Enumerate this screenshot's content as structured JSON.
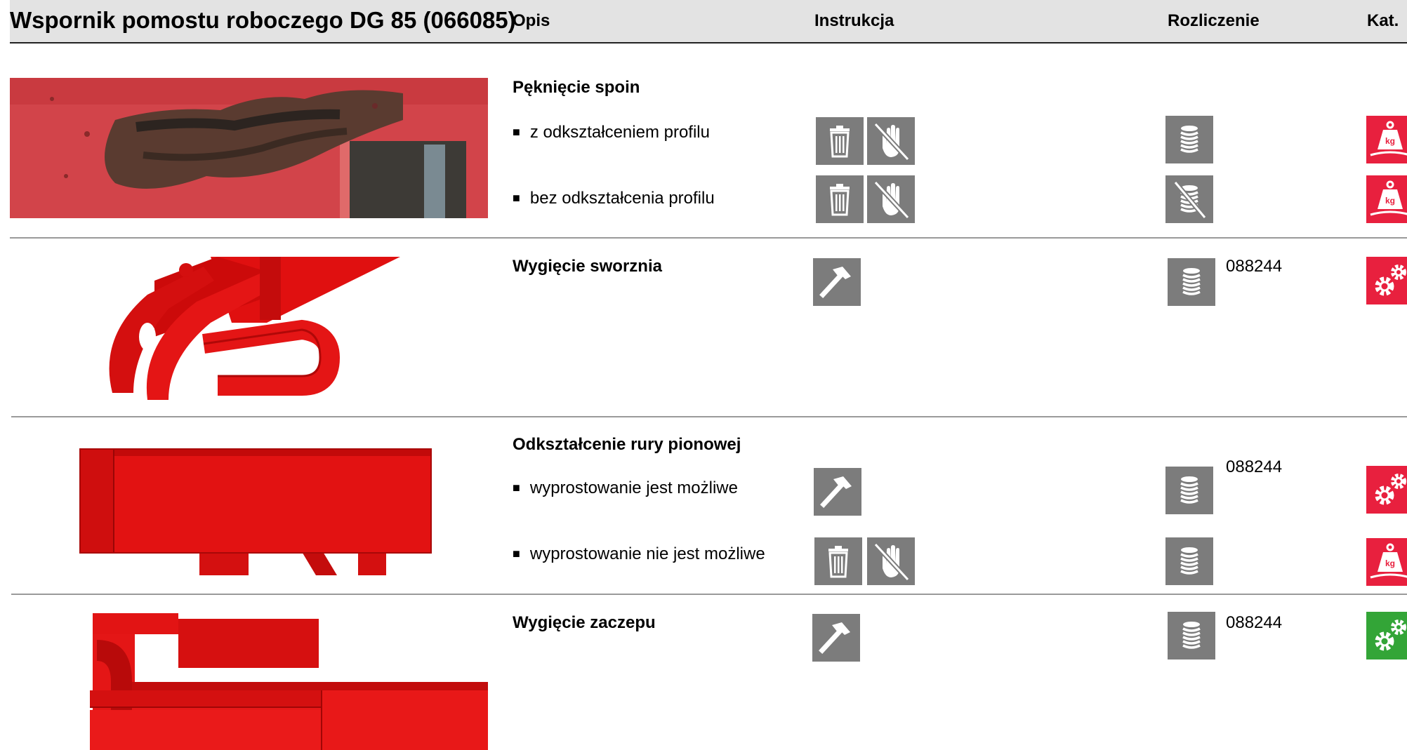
{
  "header": {
    "title": "Wspornik pomostu roboczego DG 85 (066085)",
    "columns": {
      "opis": "Opis",
      "instrukcja": "Instrukcja",
      "rozliczenie": "Rozliczenie",
      "kat": "Kat."
    }
  },
  "sections": [
    {
      "heading": "Pęknięcie spoin",
      "image": "photo of cracked, rusted weld on red profile",
      "items": [
        {
          "text": "z odkształceniem profilu",
          "instruction_icons": [
            "trash-icon",
            "no-touch-hand-icon"
          ],
          "billing_icon": "coin-stack-icon",
          "category_icon": "weight-kg-icon",
          "category_color": "#e8203e"
        },
        {
          "text": "bez odkształcenia profilu",
          "instruction_icons": [
            "trash-icon",
            "no-touch-hand-icon"
          ],
          "billing_icon": "coin-stack-crossed-icon",
          "category_icon": "weight-kg-icon",
          "category_color": "#e8203e"
        }
      ]
    },
    {
      "heading": "Wygięcie sworznia",
      "image": "3D render of bracket with bent pin",
      "instruction_icons": [
        "hammer-icon"
      ],
      "billing_icon": "coin-stack-icon",
      "billing_number": "088244",
      "category_icon": "gears-icon",
      "category_color": "#e8203e"
    },
    {
      "heading": "Odkształcenie rury pionowej",
      "image": "3D render of vertical tube profile",
      "billing_number": "088244",
      "items": [
        {
          "text": "wyprostowanie jest możliwe",
          "instruction_icons": [
            "hammer-icon"
          ],
          "billing_icon": "coin-stack-icon",
          "category_icon": "gears-icon",
          "category_color": "#e8203e"
        },
        {
          "text": "wyprostowanie nie jest możliwe",
          "instruction_icons": [
            "trash-icon",
            "no-touch-hand-icon"
          ],
          "billing_icon": "coin-stack-icon",
          "category_icon": "weight-kg-icon",
          "category_color": "#e8203e"
        }
      ]
    },
    {
      "heading": "Wygięcie zaczepu",
      "image": "3D render of bent hook profile",
      "instruction_icons": [
        "hammer-icon"
      ],
      "billing_icon": "coin-stack-icon",
      "billing_number": "088244",
      "category_icon": "gears-icon",
      "category_color": "#33a537"
    }
  ]
}
